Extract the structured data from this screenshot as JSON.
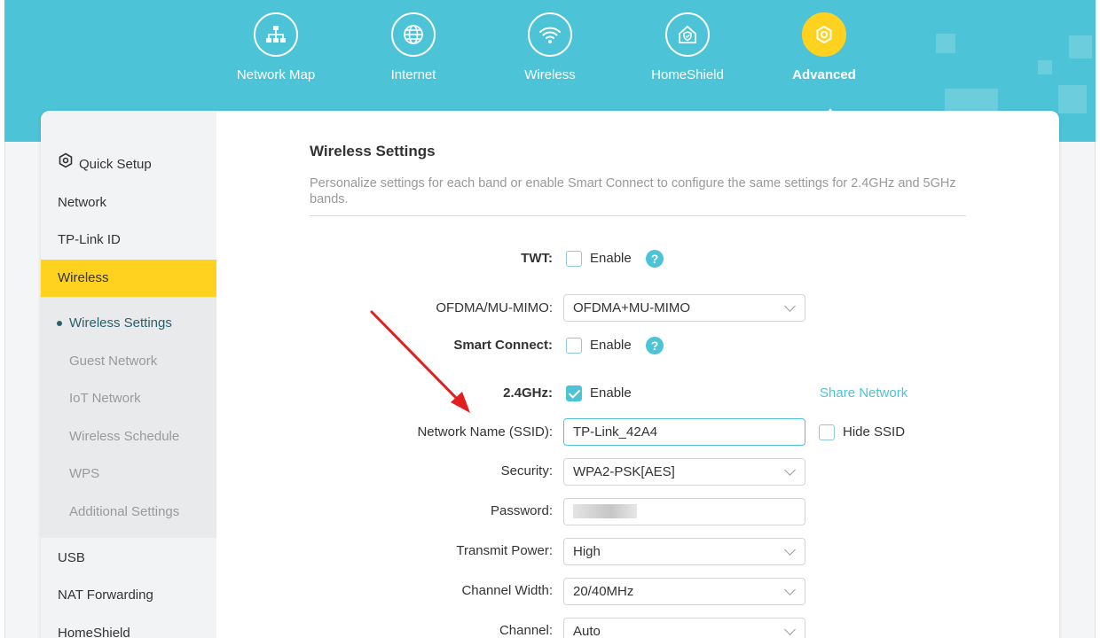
{
  "nav": {
    "items": [
      {
        "label": "Network Map",
        "icon": "network-map-icon"
      },
      {
        "label": "Internet",
        "icon": "globe-icon"
      },
      {
        "label": "Wireless",
        "icon": "wifi-icon"
      },
      {
        "label": "HomeShield",
        "icon": "home-shield-icon"
      },
      {
        "label": "Advanced",
        "icon": "advanced-gear-icon"
      }
    ],
    "active": "Advanced"
  },
  "sidebar": {
    "items": [
      {
        "label": "Quick Setup",
        "icon": "gear-icon"
      },
      {
        "label": "Network"
      },
      {
        "label": "TP-Link ID"
      },
      {
        "label": "Wireless"
      },
      {
        "label": "USB"
      },
      {
        "label": "NAT Forwarding"
      },
      {
        "label": "HomeShield"
      }
    ],
    "active": "Wireless",
    "submenu": [
      {
        "label": "Wireless Settings"
      },
      {
        "label": "Guest Network"
      },
      {
        "label": "IoT Network"
      },
      {
        "label": "Wireless Schedule"
      },
      {
        "label": "WPS"
      },
      {
        "label": "Additional Settings"
      }
    ],
    "submenu_active": "Wireless Settings"
  },
  "main": {
    "title": "Wireless Settings",
    "description": "Personalize settings for each band or enable Smart Connect to configure the same settings for 2.4GHz and 5GHz bands.",
    "twt": {
      "label": "TWT:",
      "checkbox_label": "Enable",
      "checked": false
    },
    "ofdma": {
      "label": "OFDMA/MU-MIMO:",
      "value": "OFDMA+MU-MIMO"
    },
    "smart_connect": {
      "label": "Smart Connect:",
      "checkbox_label": "Enable",
      "checked": false
    },
    "band24": {
      "label": "2.4GHz:",
      "checkbox_label": "Enable",
      "checked": true,
      "share_link": "Share Network"
    },
    "ssid": {
      "label": "Network Name (SSID):",
      "value": "TP-Link_42A4",
      "hide_label": "Hide SSID",
      "hidden": false
    },
    "security": {
      "label": "Security:",
      "value": "WPA2-PSK[AES]"
    },
    "password": {
      "label": "Password:"
    },
    "transmit_power": {
      "label": "Transmit Power:",
      "value": "High"
    },
    "channel_width": {
      "label": "Channel Width:",
      "value": "20/40MHz"
    },
    "channel": {
      "label": "Channel:",
      "value": "Auto"
    }
  },
  "colors": {
    "accent": "#4cc3d6",
    "highlight": "#ffd21f",
    "annotation_arrow": "#e02020"
  }
}
